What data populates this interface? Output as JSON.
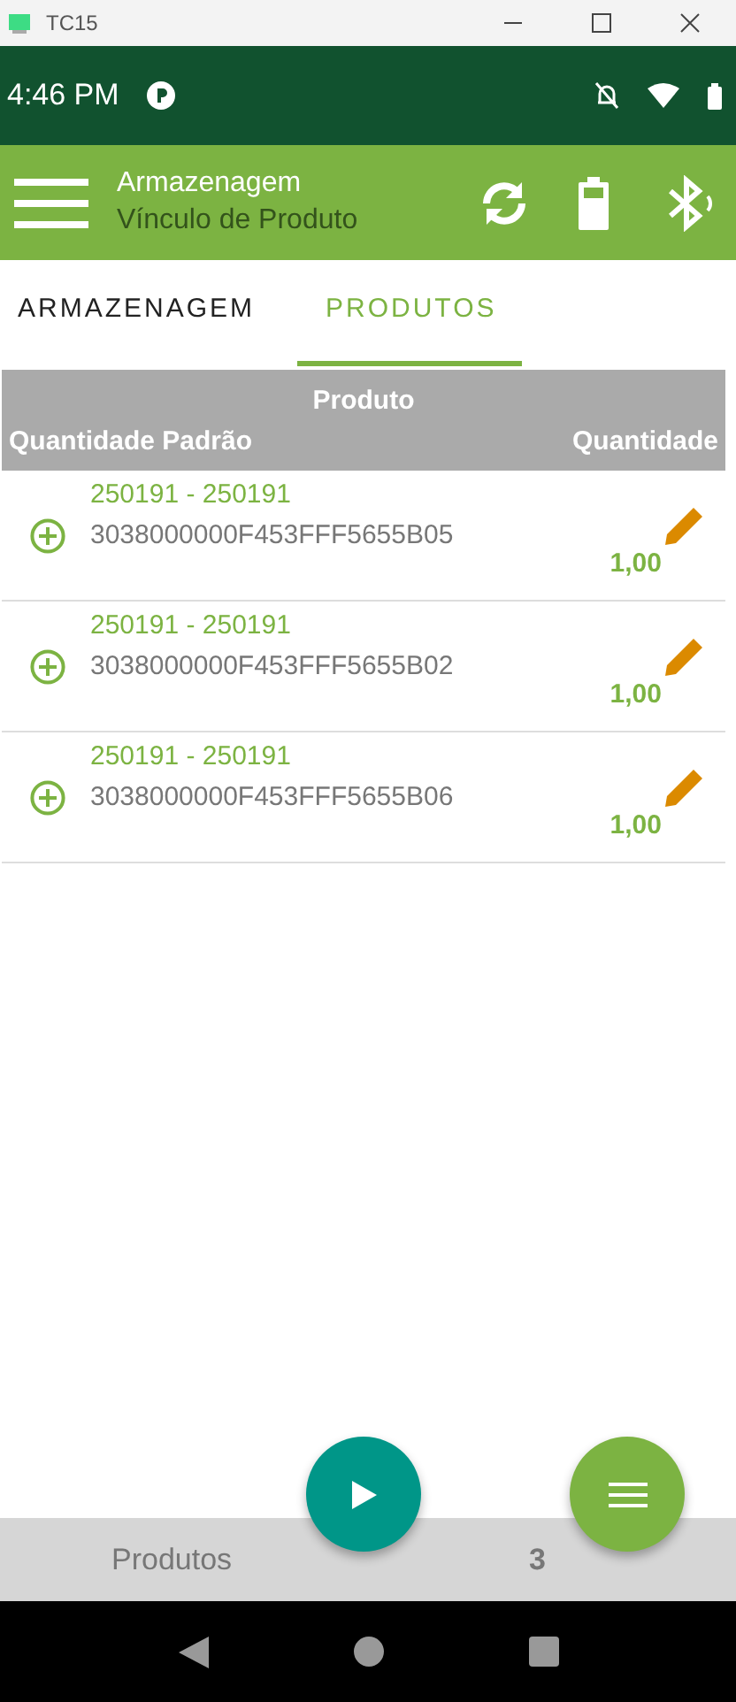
{
  "window": {
    "title": "TC15"
  },
  "status_bar": {
    "time": "4:46 PM"
  },
  "app_bar": {
    "title": "Armazenagem",
    "subtitle": "Vínculo de Produto"
  },
  "tabs": [
    {
      "label": "ARMAZENAGEM",
      "selected": false
    },
    {
      "label": "PRODUTOS",
      "selected": true
    }
  ],
  "table": {
    "columns": [
      "Produto",
      "Quantidade Padrão",
      "Quantidade"
    ],
    "rows": [
      {
        "product": "250191 - 250191",
        "tag": "3038000000F453FFF5655B05",
        "quantity": "1,00"
      },
      {
        "product": "250191 - 250191",
        "tag": "3038000000F453FFF5655B02",
        "quantity": "1,00"
      },
      {
        "product": "250191 - 250191",
        "tag": "3038000000F453FFF5655B06",
        "quantity": "1,00"
      }
    ]
  },
  "footer": {
    "label": "Produtos",
    "count": "3"
  }
}
